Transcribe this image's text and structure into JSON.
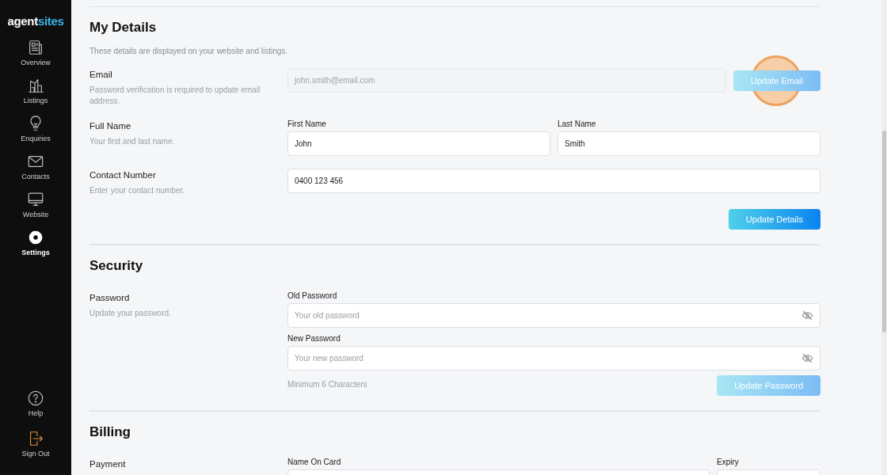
{
  "sidebar": {
    "logo": {
      "main": "agent",
      "accent": "sites"
    },
    "nav": [
      {
        "label": "Overview",
        "selected": false
      },
      {
        "label": "Listings",
        "selected": false
      },
      {
        "label": "Enquiries",
        "selected": false
      },
      {
        "label": "Contacts",
        "selected": false
      },
      {
        "label": "Website",
        "selected": false
      },
      {
        "label": "Settings",
        "selected": true
      }
    ],
    "bottom": [
      {
        "label": "Help"
      },
      {
        "label": "Sign Out"
      }
    ]
  },
  "sections": [
    {
      "title": "My Details",
      "subtitle": "These details are displayed on your website and listings.",
      "rows": [
        {
          "label": "Email",
          "hint": "Password verification is required to update email address.",
          "fields": [
            {
              "value": "john.smith@email.com",
              "disabled": true
            }
          ],
          "button": {
            "label": "Update Email",
            "disabled": true,
            "clicked": true,
            "kind": "inline"
          }
        },
        {
          "label": "Full Name",
          "hint": "Your first and last name.",
          "fields": [
            {
              "label": "First Name",
              "value": "John",
              "disabled": false
            },
            {
              "label": "Last Name",
              "value": "Smith",
              "disabled": false
            }
          ]
        },
        {
          "label": "Contact Number",
          "hint": "Enter your contact number.",
          "fields": [
            {
              "value": "0400 123 456",
              "disabled": false
            }
          ],
          "button": {
            "label": "Update Details",
            "disabled": false,
            "kind": "block"
          }
        }
      ]
    },
    {
      "title": "Security",
      "rows": [
        {
          "label": "Password",
          "hint": "Update your password.",
          "fields": [
            {
              "label": "Old Password",
              "placeholder": "Your old password",
              "kind": "password",
              "disabled": false
            },
            {
              "label": "New Password",
              "placeholder": "Your new password",
              "kind": "password",
              "disabled": false
            }
          ],
          "note": "Minimum 6 Characters",
          "button": {
            "label": "Update Password",
            "disabled": true,
            "kind": "block"
          }
        }
      ]
    },
    {
      "title": "Billing",
      "rows": [
        {
          "label": "Payment",
          "fields": [
            {
              "label": "Name On Card",
              "disabled": false
            },
            {
              "label": "Expiry",
              "disabled": false,
              "kind": "short"
            }
          ]
        }
      ]
    }
  ]
}
